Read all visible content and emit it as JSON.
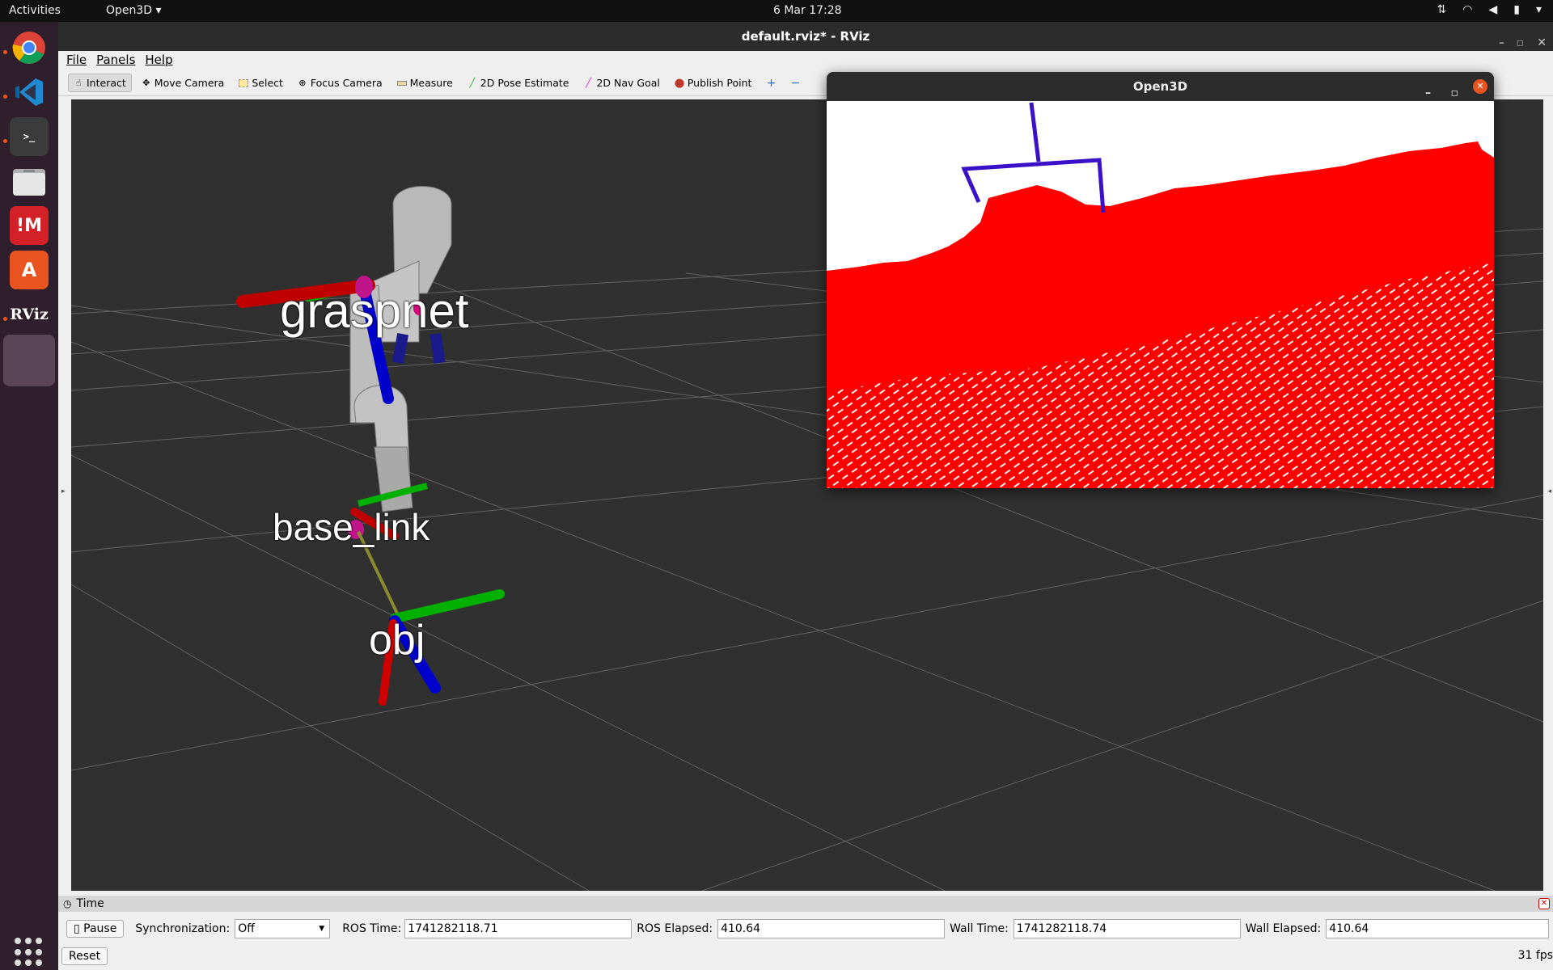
{
  "topbar": {
    "activities": "Activities",
    "app_menu": "Open3D ▾",
    "clock": "6 Mar  17:28",
    "tray_icons": [
      "network-icon",
      "wifi-icon",
      "volume-icon",
      "battery-icon",
      "power-menu-icon"
    ]
  },
  "dock": {
    "items": [
      "chrome-icon",
      "vscode-icon",
      "terminal-icon",
      "files-icon",
      "mendeley-icon",
      "software-center-icon",
      "rviz-icon",
      "open3d-icon"
    ],
    "rviz_label": "RViz"
  },
  "rviz": {
    "window_title": "default.rviz* - RViz",
    "menu": [
      "File",
      "Panels",
      "Help"
    ],
    "tools": [
      {
        "label": "Interact",
        "icon": "hand-icon",
        "active": true
      },
      {
        "label": "Move Camera",
        "icon": "move-camera-icon"
      },
      {
        "label": "Select",
        "icon": "select-icon"
      },
      {
        "label": "Focus Camera",
        "icon": "focus-camera-icon"
      },
      {
        "label": "Measure",
        "icon": "ruler-icon"
      },
      {
        "label": "2D Pose Estimate",
        "icon": "pose-estimate-icon"
      },
      {
        "label": "2D Nav Goal",
        "icon": "nav-goal-icon"
      },
      {
        "label": "Publish Point",
        "icon": "pin-icon"
      }
    ],
    "viewport_labels": {
      "graspnet": "graspnet",
      "base_link": "base_link",
      "obj": "obj"
    }
  },
  "time_panel": {
    "title": "Time",
    "pause": "Pause",
    "sync_label": "Synchronization:",
    "sync_value": "Off",
    "ros_time_label": "ROS Time:",
    "ros_time": "1741282118.71",
    "ros_elapsed_label": "ROS Elapsed:",
    "ros_elapsed": "410.64",
    "wall_time_label": "Wall Time:",
    "wall_time": "1741282118.74",
    "wall_elapsed_label": "Wall Elapsed:",
    "wall_elapsed": "410.64",
    "reset": "Reset",
    "fps": "31 fps"
  },
  "open3d": {
    "window_title": "Open3D"
  },
  "colors": {
    "point_cloud": "#ff0000",
    "gripper": "#3a10c8",
    "axis_x": "#c00000",
    "axis_y": "#00c000",
    "axis_z": "#0000d0"
  }
}
